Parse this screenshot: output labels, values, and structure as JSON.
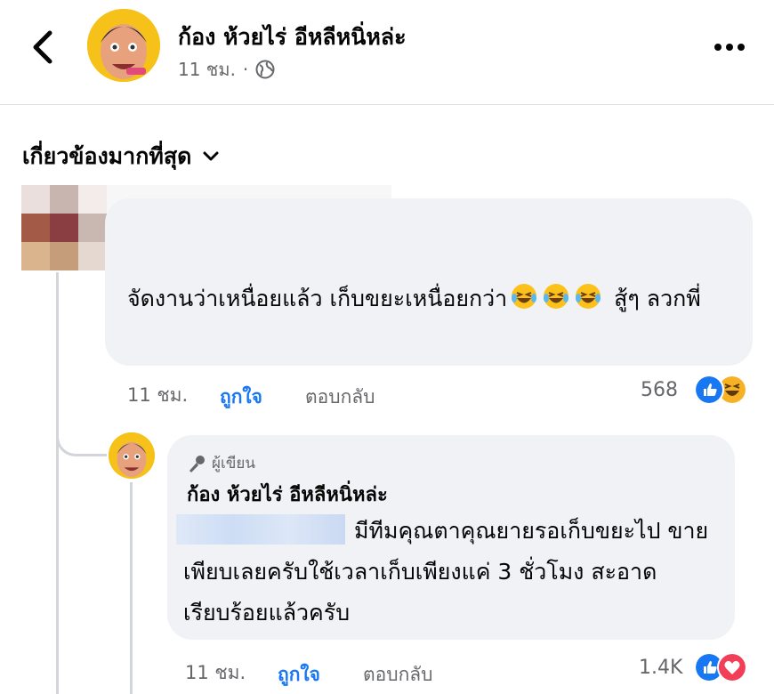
{
  "header": {
    "page_name": "ก้อง ห้วยไร่ อีหลีหนิ่หล่ะ",
    "time": "11 ชม.",
    "separator": "·"
  },
  "sort": {
    "label": "เกี่ยวข้องมากที่สุด"
  },
  "comment": {
    "text": "จัดงานว่าเหนื่อยแล้ว  เก็บขยะเหนื่อยกว่า",
    "text_end": " สู้ๆ ลวกพี่",
    "emoji_count": 3,
    "time": "11 ชม.",
    "like_label": "ถูกใจ",
    "reply_label": "ตอบกลับ",
    "reaction_count": "568",
    "reactions": [
      "like",
      "haha"
    ]
  },
  "reply": {
    "badge": "ผู้เขียน",
    "author": "ก้อง ห้วยไร่ อีหลีหนิ่หล่ะ",
    "text": "มีทีมคุณตาคุณยายรอเก็บขยะไป ขายเพียบเลยครับใช้เวลาเก็บเพียงแค่ 3 ชั่วโมง สะอาดเรียบร้อยแล้วครับ",
    "time": "11 ชม.",
    "like_label": "ถูกใจ",
    "reply_label": "ตอบกลับ",
    "reaction_count": "1.4K",
    "reactions": [
      "like",
      "love"
    ]
  },
  "colors": {
    "accent": "#1877f2",
    "muted": "#65676b",
    "bubble": "#f0f2f5",
    "love": "#f33e58",
    "haha": "#f7b125"
  }
}
